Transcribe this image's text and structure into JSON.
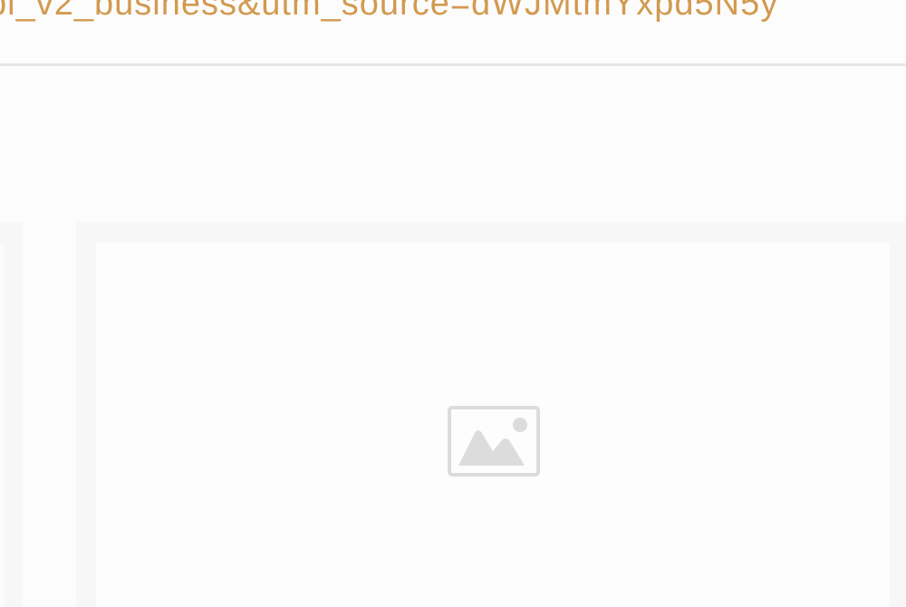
{
  "address_bar": {
    "url_fragment": "bi_v2_business&utm_source=dWJMtmYxpd5N5y"
  },
  "main": {
    "image_placeholder_icon": "image-placeholder-icon"
  },
  "colors": {
    "url_text": "#d29a50",
    "divider": "#e6e6e6",
    "card_border": "#f7f7f7",
    "placeholder_icon": "#dcdcdc"
  }
}
